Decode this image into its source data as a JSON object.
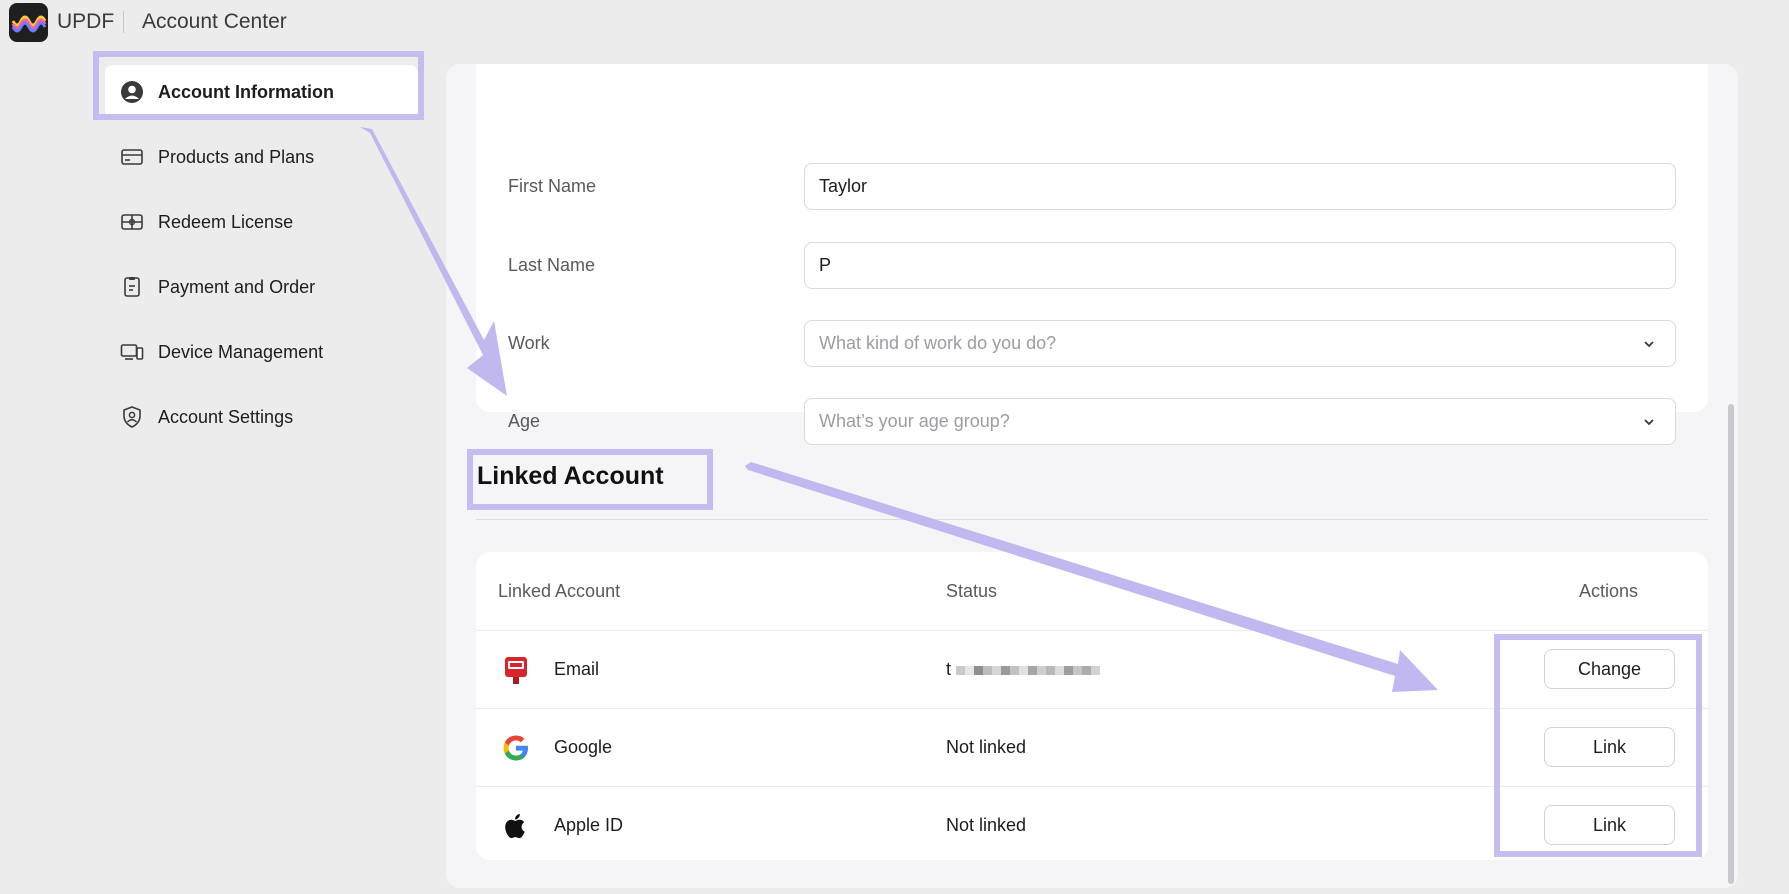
{
  "titlebar": {
    "app_name": "UPDF",
    "window_title": "Account Center"
  },
  "sidebar": {
    "items": [
      {
        "label": "Account Information",
        "icon": "user-circle-icon",
        "active": true
      },
      {
        "label": "Products and Plans",
        "icon": "credit-card-icon",
        "active": false
      },
      {
        "label": "Redeem License",
        "icon": "gift-card-icon",
        "active": false
      },
      {
        "label": "Payment and Order",
        "icon": "clipboard-icon",
        "active": false
      },
      {
        "label": "Device Management",
        "icon": "devices-icon",
        "active": false
      },
      {
        "label": "Account Settings",
        "icon": "user-shield-icon",
        "active": false
      }
    ]
  },
  "form": {
    "first_name": {
      "label": "First Name",
      "value": "Taylor"
    },
    "last_name": {
      "label": "Last Name",
      "value": "P"
    },
    "work": {
      "label": "Work",
      "placeholder": "What kind of work do you do?"
    },
    "age": {
      "label": "Age",
      "placeholder": "What’s your age group?"
    }
  },
  "linked": {
    "section_title": "Linked Account",
    "headers": {
      "account": "Linked Account",
      "status": "Status",
      "actions": "Actions"
    },
    "rows": [
      {
        "name": "Email",
        "icon": "mailbox-icon",
        "status": "t",
        "action": "Change"
      },
      {
        "name": "Google",
        "icon": "google-icon",
        "status": "Not linked",
        "action": "Link"
      },
      {
        "name": "Apple ID",
        "icon": "apple-icon",
        "status": "Not linked",
        "action": "Link"
      }
    ]
  },
  "colors": {
    "annotation": "#c4bdf0",
    "arrow": "#bdb4ee",
    "background": "#ececec",
    "panel": "#f5f5f7"
  }
}
